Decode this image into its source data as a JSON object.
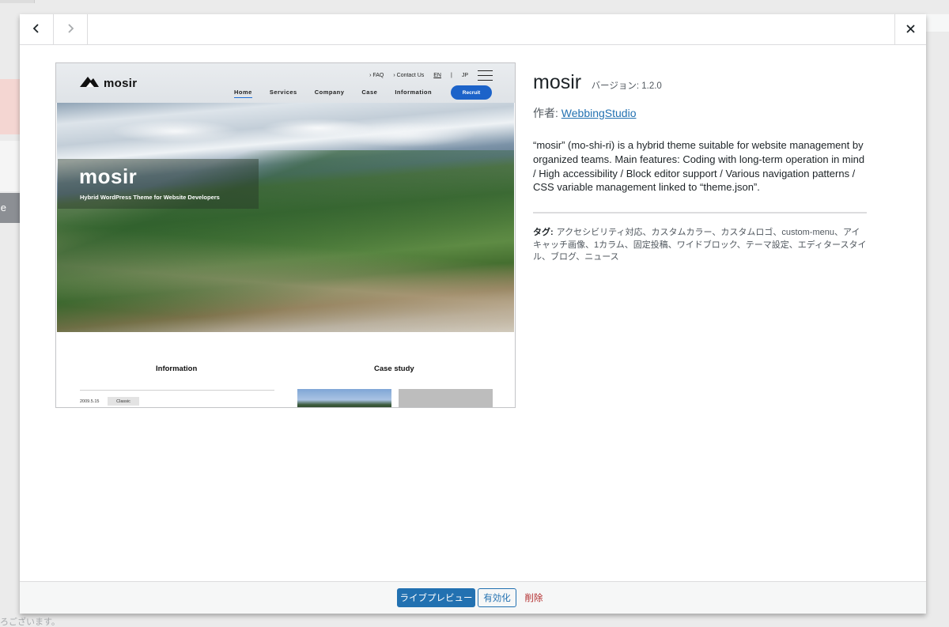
{
  "background": {
    "side_label": "e",
    "footer_text": "ろございます。"
  },
  "modal": {
    "nav": {
      "prev_icon": "chevron-left-icon",
      "next_icon": "chevron-right-icon",
      "close_icon": "close-icon"
    },
    "screenshot": {
      "logo": "mosir",
      "util_links": [
        "FAQ",
        "Contact Us"
      ],
      "langs": [
        "EN",
        "JP"
      ],
      "nav_items": [
        "Home",
        "Services",
        "Company",
        "Case",
        "Information"
      ],
      "recruit_label": "Recruit",
      "hero_title": "mosir",
      "hero_subtitle": "Hybrid WordPress Theme for Website Developers",
      "info_heading": "Information",
      "info_date": "2009.5.15",
      "info_tag": "Classic",
      "case_heading": "Case study"
    },
    "theme": {
      "name": "mosir",
      "version": "バージョン: 1.2.0",
      "author_label": "作者: ",
      "author_name": "WebbingStudio",
      "description": "“mosir” (mo-shi-ri) is a hybrid theme suitable for website management by organized teams. Main features: Coding with long-term operation in mind / High accessibility / Block editor support / Various navigation patterns / CSS variable management linked to “theme.json”.",
      "tags_label": "タグ:",
      "tags": "アクセシビリティ対応、カスタムカラー、カスタムロゴ、custom-menu、アイキャッチ画像、1カラム、固定投稿、ワイドブロック、テーマ設定、エディタースタイル、ブログ、ニュース"
    },
    "footer": {
      "live_preview": "ライブプレビュー",
      "activate": "有効化",
      "delete": "削除"
    }
  }
}
